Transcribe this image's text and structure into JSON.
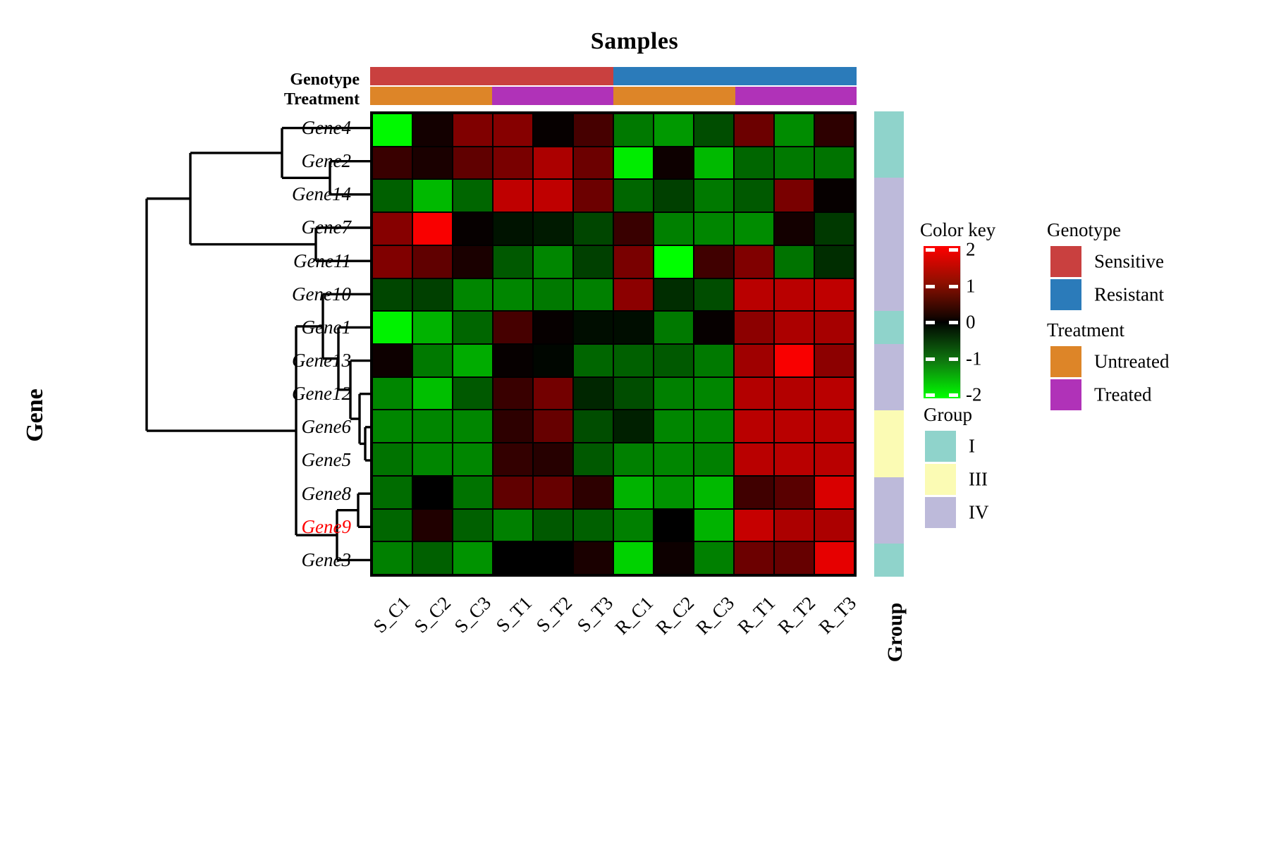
{
  "titles": {
    "samples": "Samples",
    "gene": "Gene",
    "group_axis": "Group"
  },
  "annotations": {
    "genotype_label": "Genotype",
    "treatment_label": "Treatment"
  },
  "legends": {
    "color_key": {
      "title": "Color key",
      "ticks": [
        "2",
        "1",
        "0",
        "-1",
        "-2"
      ]
    },
    "genotype": {
      "title": "Genotype",
      "items": [
        {
          "label": "Sensitive",
          "color": "#c9403f"
        },
        {
          "label": "Resistant",
          "color": "#2b7bba"
        }
      ]
    },
    "treatment": {
      "title": "Treatment",
      "items": [
        {
          "label": "Untreated",
          "color": "#dd8528"
        },
        {
          "label": "Treated",
          "color": "#b032b8"
        }
      ]
    },
    "group": {
      "title": "Group",
      "items": [
        {
          "label": "I",
          "color": "#8fd3cb"
        },
        {
          "label": "III",
          "color": "#fbfbb4"
        },
        {
          "label": "IV",
          "color": "#bdbada"
        }
      ]
    }
  },
  "chart_data": {
    "type": "heatmap",
    "title": "Samples",
    "xlabel": "Samples",
    "ylabel": "Gene",
    "colorscale": {
      "low": "#00ff00",
      "mid": "#000000",
      "high": "#ff0000",
      "zlim": [
        -2,
        2
      ]
    },
    "x": [
      "S_C1",
      "S_C2",
      "S_C3",
      "S_T1",
      "S_T2",
      "S_T3",
      "R_C1",
      "R_C2",
      "R_C3",
      "R_T1",
      "R_T2",
      "R_T3"
    ],
    "y": [
      "Gene4",
      "Gene2",
      "Gene14",
      "Gene7",
      "Gene11",
      "Gene10",
      "Gene1",
      "Gene13",
      "Gene12",
      "Gene6",
      "Gene5",
      "Gene8",
      "Gene9",
      "Gene3"
    ],
    "highlighted_row": "Gene9",
    "highlight_color": "#ff0000",
    "column_annotations": {
      "Genotype": [
        "Sensitive",
        "Sensitive",
        "Sensitive",
        "Sensitive",
        "Sensitive",
        "Sensitive",
        "Resistant",
        "Resistant",
        "Resistant",
        "Resistant",
        "Resistant",
        "Resistant"
      ],
      "Treatment": [
        "Untreated",
        "Untreated",
        "Untreated",
        "Treated",
        "Treated",
        "Treated",
        "Untreated",
        "Untreated",
        "Untreated",
        "Treated",
        "Treated",
        "Treated"
      ]
    },
    "row_annotations": {
      "Group": [
        "I",
        "I",
        "IV",
        "IV",
        "IV",
        "IV",
        "I",
        "IV",
        "IV",
        "III",
        "III",
        "IV",
        "IV",
        "I"
      ]
    },
    "values": [
      [
        -1.95,
        0.15,
        1.0,
        1.05,
        0.05,
        0.55,
        -0.95,
        -1.2,
        -0.6,
        0.85,
        -1.1,
        0.35
      ],
      [
        0.45,
        0.2,
        0.75,
        0.95,
        1.35,
        0.85,
        -1.85,
        0.1,
        -1.45,
        -0.8,
        -0.95,
        -0.9
      ],
      [
        -0.75,
        -1.45,
        -0.8,
        1.5,
        1.5,
        0.85,
        -0.8,
        -0.5,
        -0.95,
        -0.7,
        0.95,
        0.05
      ],
      [
        1.05,
        1.95,
        0.05,
        -0.15,
        -0.2,
        -0.55,
        0.45,
        -1.0,
        -1.05,
        -1.1,
        0.15,
        -0.45
      ],
      [
        1.0,
        0.75,
        0.2,
        -0.7,
        -1.05,
        -0.5,
        0.95,
        -2.0,
        0.5,
        1.0,
        -0.9,
        -0.35
      ],
      [
        -0.55,
        -0.5,
        -1.05,
        -1.05,
        -0.95,
        -1.0,
        1.1,
        -0.35,
        -0.6,
        1.45,
        1.45,
        1.5
      ],
      [
        -1.9,
        -1.4,
        -0.8,
        0.55,
        0.05,
        -0.1,
        -0.1,
        -0.95,
        0.05,
        1.1,
        1.35,
        1.3
      ],
      [
        0.1,
        -0.95,
        -1.35,
        0.05,
        -0.05,
        -0.8,
        -0.75,
        -0.7,
        -0.95,
        1.25,
        1.95,
        1.1
      ],
      [
        -1.05,
        -1.5,
        -0.7,
        0.45,
        0.9,
        -0.3,
        -0.6,
        -1.0,
        -1.05,
        1.4,
        1.4,
        1.45
      ],
      [
        -1.05,
        -1.05,
        -1.05,
        0.35,
        0.8,
        -0.6,
        -0.25,
        -1.05,
        -1.05,
        1.45,
        1.45,
        1.45
      ],
      [
        -0.9,
        -1.05,
        -1.05,
        0.4,
        0.3,
        -0.7,
        -1.0,
        -1.05,
        -1.0,
        1.45,
        1.45,
        1.45
      ],
      [
        -0.85,
        0.0,
        -0.9,
        0.75,
        0.8,
        0.35,
        -1.4,
        -1.15,
        -1.45,
        0.5,
        0.7,
        1.7
      ],
      [
        -0.8,
        0.25,
        -0.75,
        -1.0,
        -0.7,
        -0.75,
        -1.0,
        0.0,
        -1.4,
        1.55,
        1.35,
        1.35
      ],
      [
        -1.0,
        -0.75,
        -1.15,
        0.0,
        0.0,
        0.2,
        -1.65,
        0.1,
        -1.0,
        0.85,
        0.8,
        1.8
      ]
    ]
  }
}
